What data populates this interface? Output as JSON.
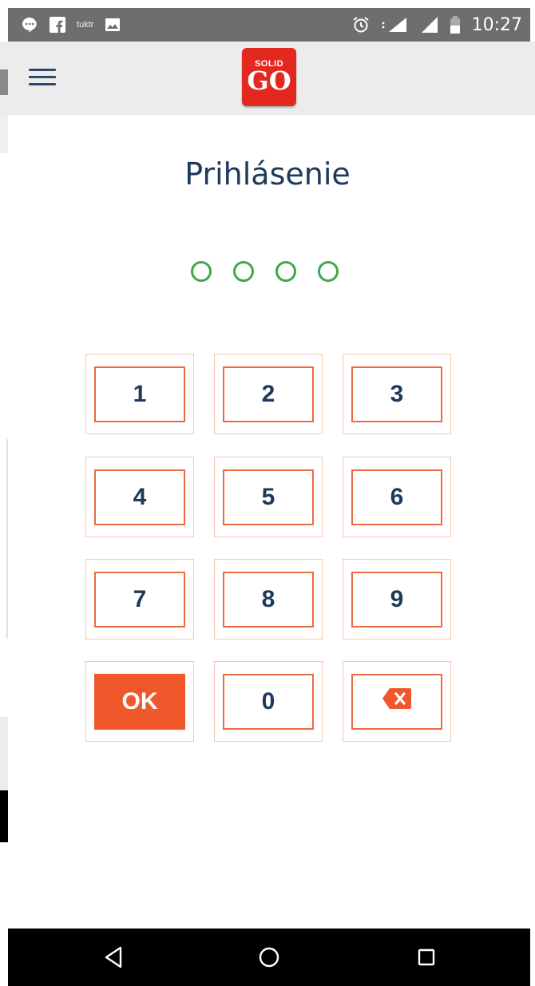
{
  "status_bar": {
    "left_icons": [
      "message-icon",
      "facebook-icon",
      "small-app-icon",
      "image-icon"
    ],
    "small_app_label": "tuktr",
    "right_icons": [
      "alarm-icon",
      "signal-4g-icon",
      "signal-icon",
      "battery-icon"
    ],
    "network_label": "4G",
    "time": "10:27"
  },
  "app_bar": {
    "menu_icon": "hamburger-menu-icon",
    "logo_top": "SOLID",
    "logo_bottom": "GO",
    "logo_color": "#e32820"
  },
  "screen": {
    "title": "Prihlásenie",
    "pin_length": 4,
    "pin_entered": 0,
    "pin_indicator_color": "#3ea84a"
  },
  "keypad": {
    "keys": [
      "1",
      "2",
      "3",
      "4",
      "5",
      "6",
      "7",
      "8",
      "9",
      "OK",
      "0"
    ],
    "backspace_icon": "backspace-icon",
    "accent_color": "#f0582b"
  },
  "nav_bar": {
    "icons": [
      "back-icon",
      "home-icon",
      "recents-icon"
    ]
  }
}
